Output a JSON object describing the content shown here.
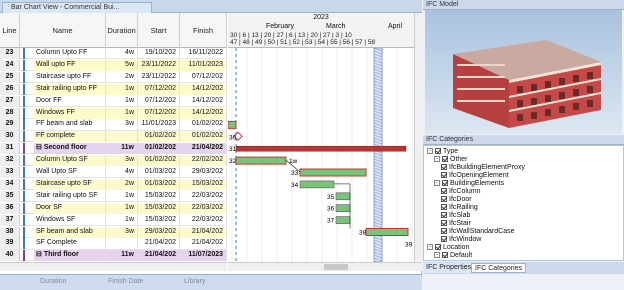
{
  "window_tab": {
    "label": "Bar Chart View - Commercial Bui...",
    "close": "x"
  },
  "columns": {
    "line": "Line",
    "name": "Name",
    "duration": "Duration",
    "start": "Start",
    "finish": "Finish"
  },
  "timeline": {
    "year": "2023",
    "months": [
      "February",
      "March",
      "April"
    ],
    "days_row": "30 | 6 | 13 | 20 | 27 | 6 | 13 | 20 | 27 | 3 | 10",
    "weeks_row": "47 | 48 | 49 | 50 | 51 | 52 | 53 | 54 | 55 | 56 | 57 | 58"
  },
  "rows": [
    {
      "line": "23",
      "name": "Column Upto FF",
      "duration": "4w",
      "start": "19/10/202",
      "finish": "16/11/2022",
      "style": "plain"
    },
    {
      "line": "24",
      "name": "Wall upto FF",
      "duration": "5w",
      "start": "23/11/2022",
      "finish": "11/01/2023",
      "style": "yellow"
    },
    {
      "line": "25",
      "name": "Staircase upto FF",
      "duration": "2w",
      "start": "23/11/2022",
      "finish": "07/12/202",
      "style": "plain"
    },
    {
      "line": "26",
      "name": "Stair railing upto FF",
      "duration": "1w",
      "start": "07/12/202",
      "finish": "14/12/202",
      "style": "yellow"
    },
    {
      "line": "27",
      "name": "Door FF",
      "duration": "1w",
      "start": "07/12/202",
      "finish": "14/12/202",
      "style": "plain"
    },
    {
      "line": "28",
      "name": "Windows FF",
      "duration": "1w",
      "start": "07/12/202",
      "finish": "14/12/202",
      "style": "yellow"
    },
    {
      "line": "29",
      "name": "FF beam and slab",
      "duration": "3w",
      "start": "11/01/2023",
      "finish": "01/02/202",
      "style": "plain"
    },
    {
      "line": "30",
      "name": "FF complete",
      "duration": "",
      "start": "01/02/202",
      "finish": "01/02/202",
      "style": "yellow"
    },
    {
      "line": "31",
      "name": "Second floor",
      "duration": "11w",
      "start": "01/02/202",
      "finish": "21/04/202",
      "style": "summary"
    },
    {
      "line": "32",
      "name": "Column Upto SF",
      "duration": "3w",
      "start": "01/02/202",
      "finish": "22/02/202",
      "style": "yellow"
    },
    {
      "line": "33",
      "name": "Wall Upto SF",
      "duration": "4w",
      "start": "01/03/202",
      "finish": "29/03/202",
      "style": "plain"
    },
    {
      "line": "34",
      "name": "Staircase upto SF",
      "duration": "2w",
      "start": "01/03/202",
      "finish": "15/03/202",
      "style": "yellow"
    },
    {
      "line": "35",
      "name": "Stair railing upto SF",
      "duration": "1w",
      "start": "15/03/202",
      "finish": "22/03/202",
      "style": "plain"
    },
    {
      "line": "36",
      "name": "Door SF",
      "duration": "1w",
      "start": "15/03/202",
      "finish": "22/03/202",
      "style": "yellow"
    },
    {
      "line": "37",
      "name": "Windows SF",
      "duration": "1w",
      "start": "15/03/202",
      "finish": "22/03/202",
      "style": "plain"
    },
    {
      "line": "38",
      "name": "SF beam and slab",
      "duration": "3w",
      "start": "29/03/202",
      "finish": "21/04/202",
      "style": "yellow"
    },
    {
      "line": "39",
      "name": "SF Complete",
      "duration": "",
      "start": "21/04/202",
      "finish": "21/04/202",
      "style": "plain"
    },
    {
      "line": "40",
      "name": "Third floor",
      "duration": "11w",
      "start": "21/04/202",
      "finish": "11/07/2023",
      "style": "summary"
    }
  ],
  "gantt_labels": [
    "30",
    "31",
    "32",
    "1w",
    "33",
    "34",
    "35",
    "36",
    "37",
    "38",
    "39"
  ],
  "bottom_toolbar": {
    "duration": "Duration",
    "finish_date": "Finish Date",
    "library": "Library"
  },
  "right_panel": {
    "model_title": "IFC Model",
    "categories_title": "IFC Categories",
    "tree": [
      {
        "label": "Type",
        "level": 0,
        "expander": true
      },
      {
        "label": "Other",
        "level": 1,
        "expander": true
      },
      {
        "label": "IfcBuildingElementProxy",
        "level": 2,
        "expander": false
      },
      {
        "label": "IfcOpeningElement",
        "level": 2,
        "expander": false
      },
      {
        "label": "BuildingElements",
        "level": 1,
        "expander": true
      },
      {
        "label": "IfcColumn",
        "level": 2,
        "expander": false
      },
      {
        "label": "IfcDoor",
        "level": 2,
        "expander": false
      },
      {
        "label": "IfcRailing",
        "level": 2,
        "expander": false
      },
      {
        "label": "IfcSlab",
        "level": 2,
        "expander": false
      },
      {
        "label": "IfcStair",
        "level": 2,
        "expander": false
      },
      {
        "label": "IfcWallStandardCase",
        "level": 2,
        "expander": false
      },
      {
        "label": "IfcWindow",
        "level": 2,
        "expander": false
      },
      {
        "label": "Location",
        "level": 0,
        "expander": true
      },
      {
        "label": "Default",
        "level": 1,
        "expander": true
      }
    ],
    "tabs": [
      "IFC Properties",
      "IFC Categories"
    ]
  },
  "colors": {
    "accent": "#3d6fc4",
    "task_bar": "#7ac47a",
    "summary_bar": "#c0392b",
    "critical": "#d32f2f"
  }
}
